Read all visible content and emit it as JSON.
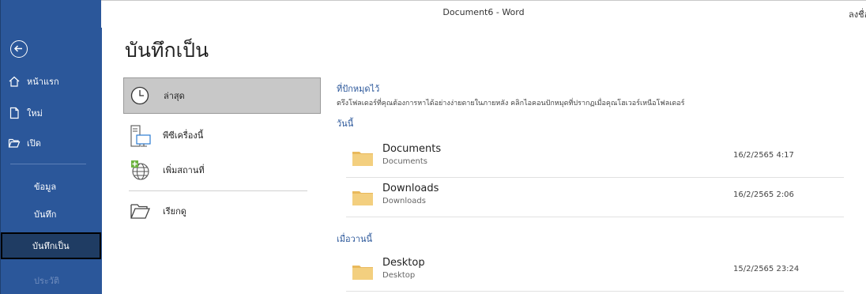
{
  "window": {
    "title": "Document6  -  Word",
    "signin_label": "ลงชื่อเข้าใช้"
  },
  "sidebar": {
    "back_icon": "back-arrow-circle-icon",
    "items": [
      {
        "label": "หน้าแรก",
        "icon": "home-icon"
      },
      {
        "label": "ใหม่",
        "icon": "new-document-icon"
      },
      {
        "label": "เปิด",
        "icon": "open-folder-icon"
      }
    ],
    "sub_items": [
      {
        "label": "ข้อมูล"
      },
      {
        "label": "บันทึก"
      },
      {
        "label": "บันทึกเป็น",
        "selected": true
      },
      {
        "label": "ประวัติ",
        "disabled": true
      }
    ],
    "accent": "#2b579a"
  },
  "page": {
    "title": "บันทึกเป็น"
  },
  "locations": [
    {
      "label": "ล่าสุด",
      "icon": "clock-icon",
      "selected": true
    },
    {
      "label": "พีซีเครื่องนี้",
      "icon": "this-pc-icon"
    },
    {
      "label": "เพิ่มสถานที่",
      "icon": "add-place-globe-icon"
    },
    {
      "label": "เรียกดู",
      "icon": "browse-folder-icon"
    }
  ],
  "pinned": {
    "title": "ที่ปักหมุดไว้",
    "description": "ตรึงโฟลเดอร์ที่คุณต้องการหาได้อย่างง่ายดายในภายหลัง คลิกไอคอนปักหมุดที่ปรากฏเมื่อคุณโฮเวอร์เหนือโฟลเดอร์"
  },
  "today": {
    "title": "วันนี้",
    "folders": [
      {
        "name": "Documents",
        "path": "Documents",
        "date": "16/2/2565 4:17"
      },
      {
        "name": "Downloads",
        "path": "Downloads",
        "date": "16/2/2565 2:06"
      }
    ]
  },
  "yesterday": {
    "title": "เมื่อวานนี้",
    "folders": [
      {
        "name": "Desktop",
        "path": "Desktop",
        "date": "15/2/2565 23:24"
      }
    ]
  }
}
